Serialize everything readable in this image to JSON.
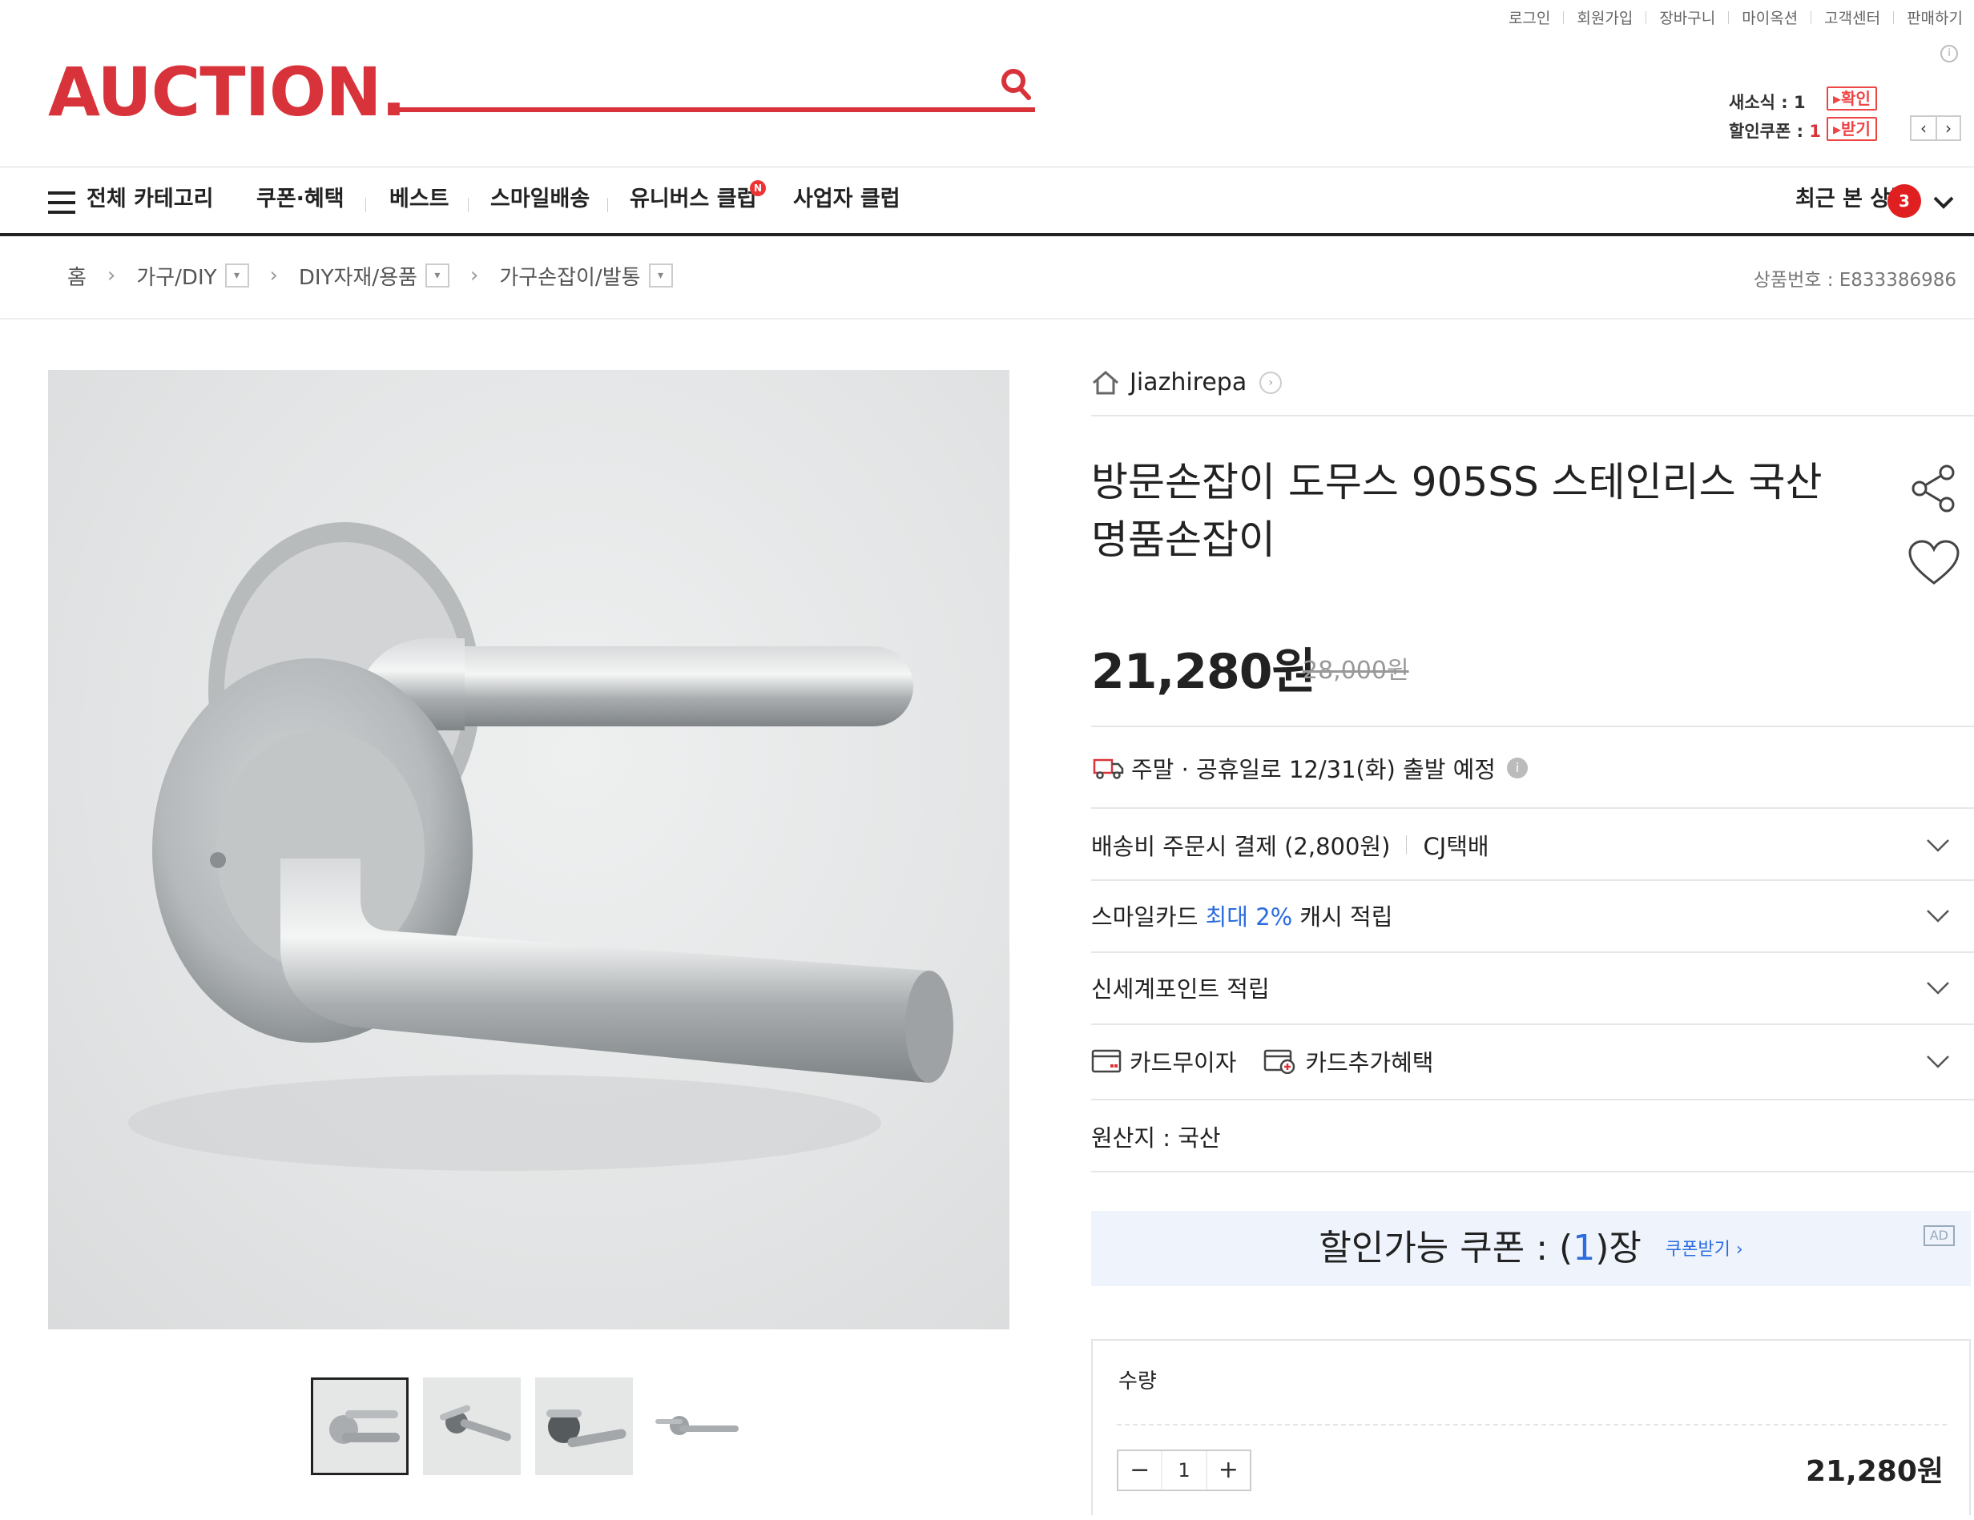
{
  "util_links": [
    "로그인",
    "회원가입",
    "장바구니",
    "마이옥션",
    "고객센터",
    "판매하기"
  ],
  "logo": "AUCTION.",
  "search": {
    "placeholder": ""
  },
  "messages": {
    "news_label": "새소식 : ",
    "news_count": "1",
    "coupon_label": "할인쿠폰 : ",
    "coupon_count": "1",
    "check_btn": "▸확인",
    "receive_btn": "▸받기"
  },
  "nav": {
    "all_category": "전체 카테고리",
    "items": [
      "쿠폰·혜택",
      "베스트",
      "스마일배송",
      "유니버스 클럽",
      "사업자 클럽"
    ],
    "new_badge": "N",
    "recent_label": "최근 본 상품",
    "recent_count": "3"
  },
  "breadcrumb": {
    "home": "홈",
    "levels": [
      "가구/DIY",
      "DIY자재/용품",
      "가구손잡이/발통"
    ]
  },
  "product_no": "상품번호 : E833386986",
  "seller": "Jiazhirepa",
  "title": "방문손잡이 도무스 905SS 스테인리스 국산 명품손잡이",
  "price": {
    "current": "21,280원",
    "original": "28,000원"
  },
  "shipping_note": "주말 · 공휴일로 12/31(화) 출발 예정",
  "delivery": {
    "fee": "배송비 주문시 결제 (2,800원)",
    "carrier": "CJ택배"
  },
  "smile_card": {
    "prefix": "스마일카드 ",
    "highlight": "최대 2%",
    "suffix": " 캐시 적립"
  },
  "shinsegae": "신세계포인트 적립",
  "card": {
    "interest_free": "카드무이자",
    "extra": "카드추가혜택"
  },
  "origin": "원산지 : 국산",
  "coupon": {
    "prefix": "할인가능 쿠폰 : (",
    "count": "1",
    "suffix": ")장",
    "link": "쿠폰받기 ›",
    "ad": "AD"
  },
  "quantity": {
    "label": "수량",
    "value": "1",
    "minus": "−",
    "plus": "+",
    "total": "21,280원"
  },
  "colors": {
    "brand": "#d8333b",
    "accent_blue": "#2b6ce0"
  }
}
